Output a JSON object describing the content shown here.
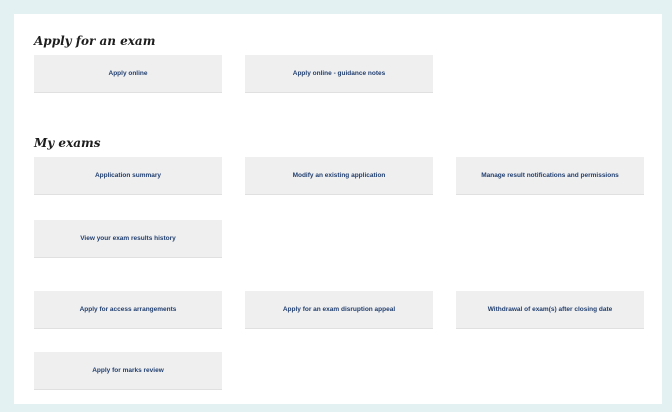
{
  "apply_section": {
    "title": "Apply for an exam",
    "buttons": {
      "apply_online": "Apply online",
      "guidance_notes": "Apply online - guidance notes"
    }
  },
  "my_exams_section": {
    "title": "My exams",
    "buttons": {
      "application_summary": "Application summary",
      "modify_application": "Modify an existing application",
      "manage_notifications": "Manage result notifications and permissions",
      "results_history": "View your exam results history",
      "access_arrangements": "Apply for access arrangements",
      "disruption_appeal": "Apply for an exam disruption appeal",
      "withdrawal": "Withdrawal of exam(s) after closing date",
      "marks_review": "Apply for marks review"
    }
  }
}
